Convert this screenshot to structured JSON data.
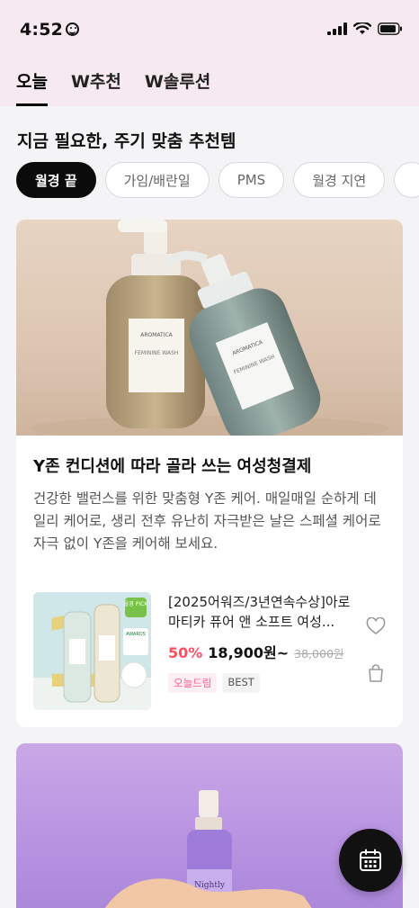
{
  "status": {
    "time": "4:52"
  },
  "tabs": [
    {
      "label": "오늘",
      "active": true
    },
    {
      "label": "W추천",
      "active": false
    },
    {
      "label": "W솔루션",
      "active": false
    }
  ],
  "section_title": "지금 필요한, 주기 맞춤 추천템",
  "chips": [
    {
      "label": "월경 끝",
      "active": true
    },
    {
      "label": "가임/배란일",
      "active": false
    },
    {
      "label": "PMS",
      "active": false
    },
    {
      "label": "월경 지연",
      "active": false
    }
  ],
  "card": {
    "image_brand": "AROMATICA",
    "image_label": "FEMININE WASH",
    "title": "Y존 컨디션에 따라 골라 쓰는 여성청결제",
    "description": "건강한 밸런스를 위한 맞춤형 Y존 케어. 매일매일 순하게 데일리 케어로, 생리 전후 유난히 자극받은 날은 스페셜 케어로 자극 없이 Y존을 케어해 보세요.",
    "product": {
      "name": "[2025어워즈/3년연속수상]아로마티카 퓨어 앤 소프트 여성...",
      "discount": "50%",
      "price": "18,900원~",
      "original_price": "38,000원",
      "badges": [
        "오늘드림",
        "BEST"
      ],
      "thumb_badge_top": "올영 PICK",
      "thumb_badge_mid": "AWARDS"
    }
  },
  "card2": {
    "image_label": "Nightly"
  },
  "icons": {
    "heart": "heart-icon",
    "bag": "shopping-bag-icon",
    "calendar": "calendar-icon"
  }
}
